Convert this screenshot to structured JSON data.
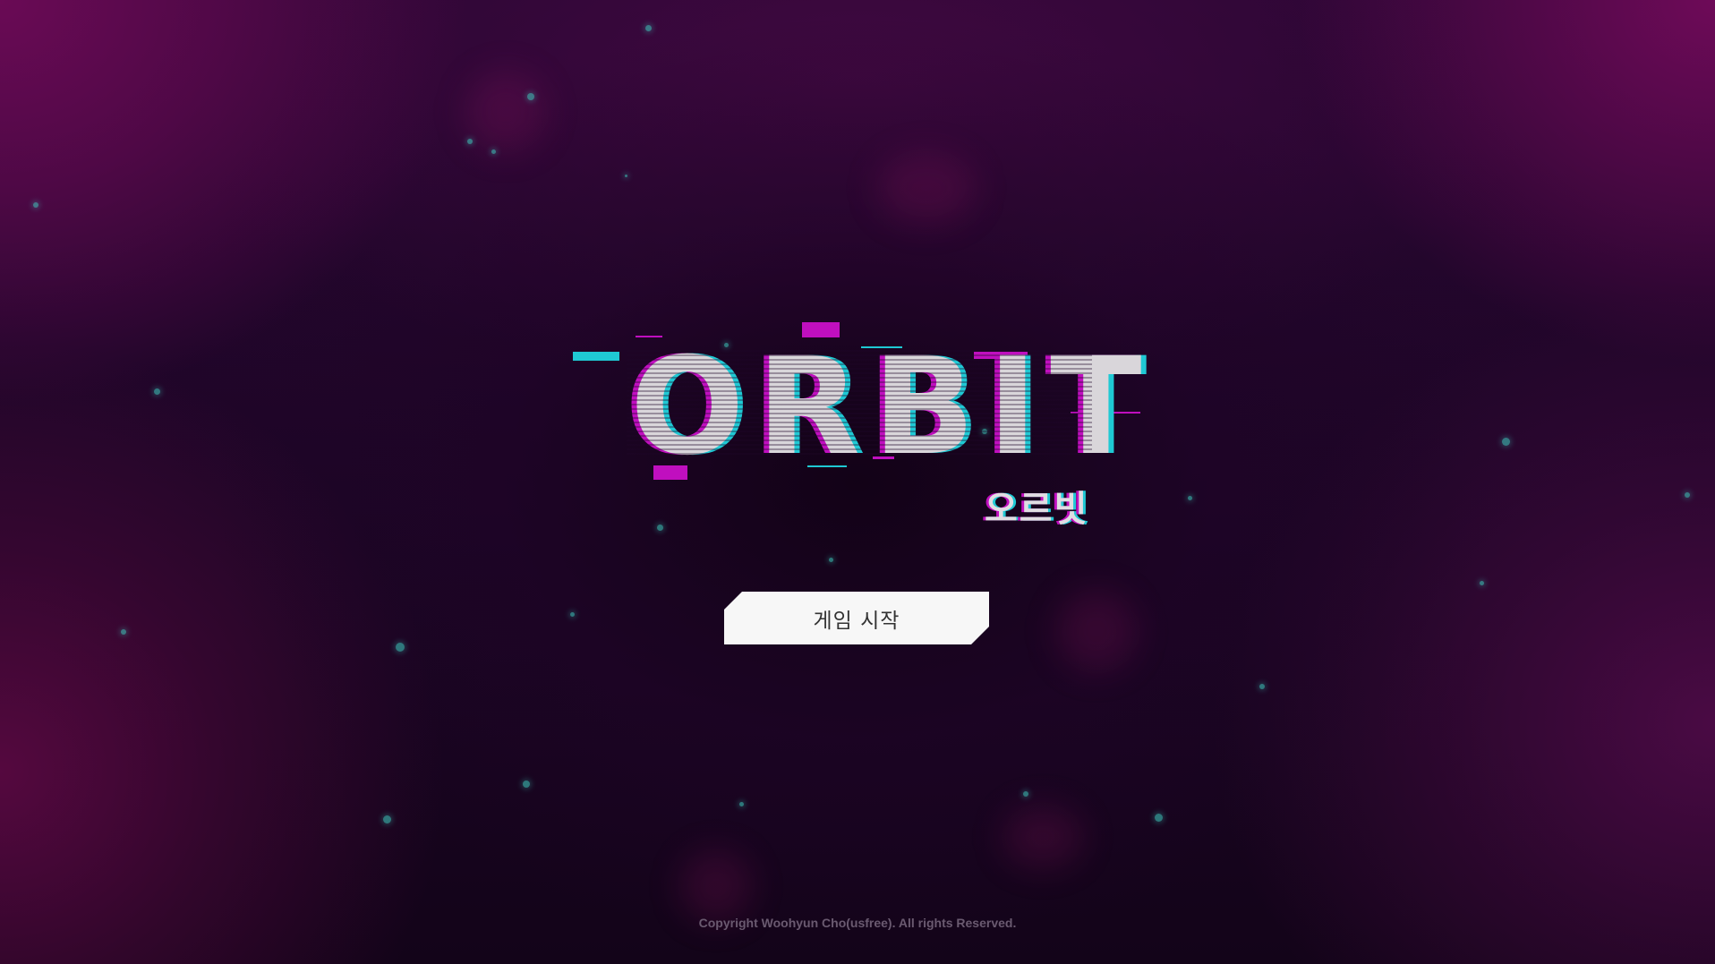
{
  "game": {
    "title": "ORBIT",
    "subtitle": "오르빗",
    "start_button_label": "게임 시작",
    "copyright": "Copyright Woohyun Cho(usfree). All rights Reserved."
  },
  "colors": {
    "accent_magenta": "#c00fbf",
    "accent_cyan": "#1fc9d4",
    "logo_text": "#d9d6da",
    "button_bg": "#f7f7f7",
    "button_text": "#333333",
    "particle": "#3fd6c6",
    "background_dark": "#1a0620",
    "background_magenta": "#6a0a55"
  }
}
